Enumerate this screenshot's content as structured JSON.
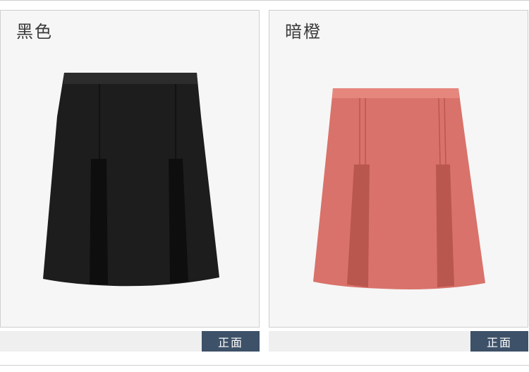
{
  "products": [
    {
      "color_name": "黑色",
      "view_label": "正面",
      "fabric_color": "#1d1d1d",
      "shade_color": "#0e0e0e",
      "highlight_color": "#2c2c2c"
    },
    {
      "color_name": "暗橙",
      "view_label": "正面",
      "fabric_color": "#d9726a",
      "shade_color": "#b9574f",
      "highlight_color": "#e6877e"
    }
  ]
}
